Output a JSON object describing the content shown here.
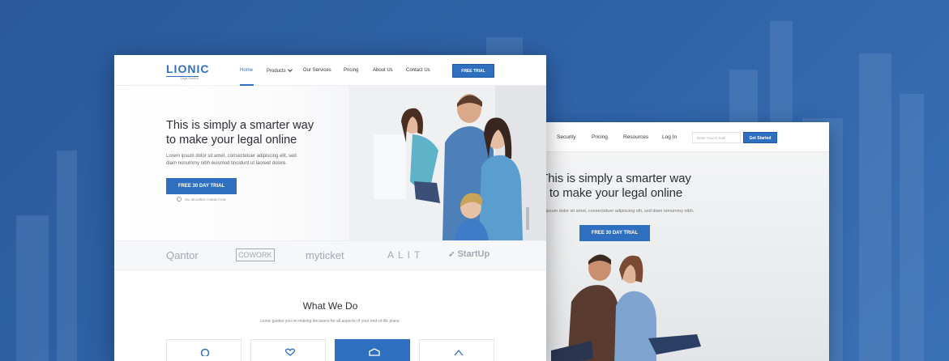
{
  "background": {
    "color": "#2f63a8"
  },
  "secondary_page": {
    "nav": {
      "items": [
        "Security",
        "Pricing",
        "Resources",
        "Log In"
      ],
      "email_placeholder": "Enter Your E-mail",
      "cta": "Get Started"
    },
    "hero": {
      "title_line1": "This is simply a smarter way",
      "title_line2": "to make your legal online",
      "subtitle": "ipsum dolor sit amet, consectetuer adipiscing elit, sed diam nonummy nibh.",
      "button": "FREE 30 DAY TRIAL"
    }
  },
  "main_page": {
    "logo": {
      "name": "LIONIC",
      "tagline": "Legal Solution"
    },
    "nav": {
      "items": [
        "Home",
        "Products",
        "Our Services",
        "Pricing",
        "About Us",
        "Contact Us"
      ],
      "active": "Home",
      "cta": "FREE TRIAL"
    },
    "hero": {
      "title_line1": "This is simply a smarter way",
      "title_line2": "to make your legal online",
      "desc_line1": "Lorem ipsum dolor sit amet, consectetuer adipiscing elit, sed",
      "desc_line2": "diam nonummy nibh euismod tincidunt ut laoreet dolore.",
      "button": "FREE 30 DAY TRIAL",
      "ssl_note": "SSL SECURED CONNECTION"
    },
    "partners": [
      "Qantor",
      "COWORK",
      "myticket",
      "ALIT",
      "StartUp"
    ],
    "what_we_do": {
      "title": "What We Do",
      "subtitle": "Lionic guides you on making decisions for all aspects of your end-of-life plans."
    },
    "accent_color": "#2f6fbf"
  }
}
